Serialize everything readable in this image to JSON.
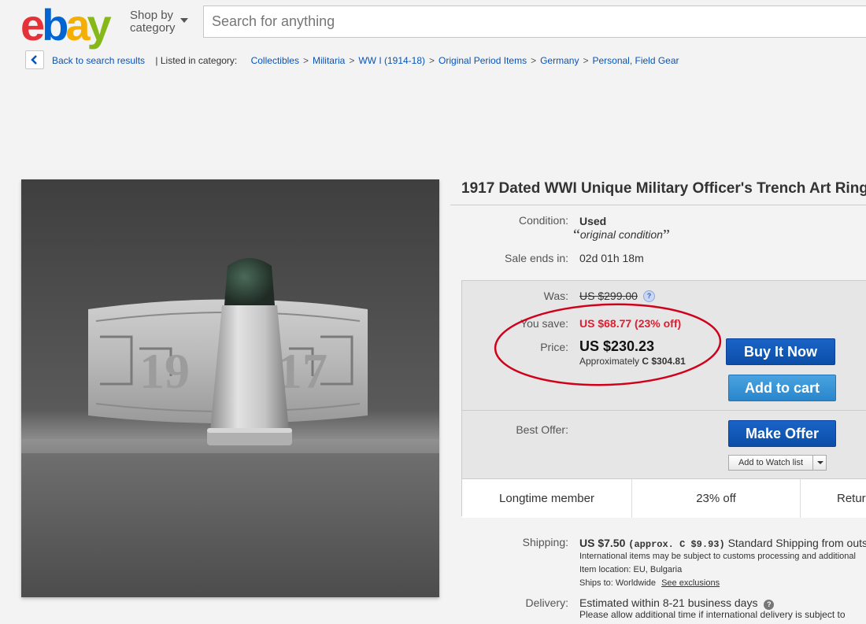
{
  "header": {
    "logo": {
      "letters": [
        "e",
        "b",
        "a",
        "y"
      ],
      "colors": [
        "#e53238",
        "#0064d2",
        "#f5af02",
        "#86b817"
      ]
    },
    "shop_by_line1": "Shop by",
    "shop_by_line2": "category",
    "search_placeholder": "Search for anything"
  },
  "breadcrumb": {
    "back_label": "Back to search results",
    "listed_label": "| Listed in category:",
    "items": [
      "Collectibles",
      "Militaria",
      "WW I (1914-18)",
      "Original Period Items",
      "Germany",
      "Personal, Field Gear"
    ],
    "separator": ">"
  },
  "listing": {
    "title": "1917 Dated WWI Unique Military Officer's Trench Art Ring",
    "condition_label": "Condition:",
    "condition_value": "Used",
    "condition_note_open": "“",
    "condition_note": "original condition",
    "condition_note_close": "”",
    "sale_ends_label": "Sale ends in:",
    "sale_ends_value": "02d 01h 18m"
  },
  "price": {
    "was_label": "Was:",
    "was_value": "US $299.00",
    "help_glyph": "?",
    "save_label": "You save:",
    "save_value": "US $68.77 (23% off)",
    "price_label": "Price:",
    "price_value": "US $230.23",
    "approx_prefix": "Approximately",
    "approx_value": "C $304.81",
    "buy_now": "Buy It Now",
    "add_to_cart": "Add to cart",
    "best_offer_label": "Best Offer:",
    "make_offer": "Make Offer",
    "watch_list": "Add to Watch list",
    "highlight_color": "#d0021b",
    "save_color": "#dd1e31"
  },
  "stats": [
    "Longtime member",
    "23% off",
    "Retur"
  ],
  "shipping": {
    "label": "Shipping:",
    "cost": "US $7.50",
    "approx": "(approx. C $9.93)",
    "service": "Standard Shipping from outside",
    "note": "International items may be subject to customs processing and additional",
    "location_label": "Item location:",
    "location_value": "EU, Bulgaria",
    "ships_to_label": "Ships to:",
    "ships_to_value": "Worldwide",
    "exclusions_link": "See exclusions"
  },
  "delivery": {
    "label": "Delivery:",
    "value": "Estimated within 8-21 business days",
    "help_glyph": "?",
    "note": "Please allow additional time if international delivery is subject to"
  }
}
